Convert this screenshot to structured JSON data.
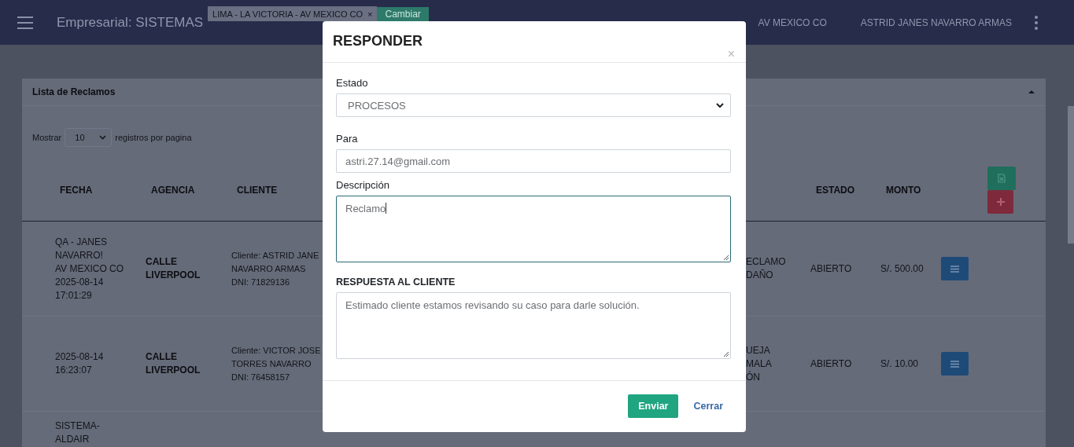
{
  "navbar": {
    "title": "Empresarial: SISTEMAS",
    "branch_select": "LIMA - LA VICTORIA - AV MEXICO CO",
    "branch_clear": "×",
    "change_button": "Cambiar",
    "branch_name": "AV MEXICO CO",
    "user_name": "ASTRID JANES NAVARRO ARMAS"
  },
  "card": {
    "title": "Lista de Reclamos",
    "length_label": "Mostrar",
    "length_value": "10",
    "length_suffix": "registros por pagina",
    "columns": [
      "FECHA",
      "AGENCIA",
      "CLIENTE",
      "ESTADO",
      "MONTO"
    ],
    "rows": [
      {
        "fecha": "QA - JANES NAVARRO!\nAV MEXICO CO\n2025-08-14\n17:01:29",
        "agencia": "CALLE\nLIVERPOOL",
        "cliente": "Cliente: ASTRID JANE\nNAVARRO ARMAS\nDNI: 71829136",
        "column_4": "ECLAMO\n DAÑO",
        "estado": "ABIERTO",
        "monto": "S/. 500.00"
      },
      {
        "fecha": "2025-08-14\n16:23:07",
        "agencia": "CALLE\nLIVERPOOL",
        "cliente": "Cliente: VICTOR JOSE\nTORRES NAVARRO\nDNI: 76458157",
        "column_4": "UEJA\n MALA\nÓN",
        "estado": "ABIERTO",
        "monto": "S/. 10.00"
      },
      {
        "fecha": "SISTEMA-\nALDAIR"
      }
    ]
  },
  "modal": {
    "title": "RESPONDER",
    "close": "×",
    "fields": [
      {
        "kind": "select",
        "label": "Estado",
        "value": "PROCESOS",
        "focused": false,
        "strong": false
      },
      {
        "kind": "input",
        "label": "Para",
        "value": "astri.27.14@gmail.com",
        "focused": false,
        "strong": false
      },
      {
        "kind": "textarea",
        "label": "Descripción",
        "value": "Reclamo",
        "focused": true,
        "strong": false
      },
      {
        "kind": "textarea",
        "label": "RESPUESTA AL CLIENTE",
        "value": "Estimado cliente estamos revisando su caso para darle solución.",
        "focused": false,
        "strong": true
      }
    ],
    "buttons": [
      {
        "kind": "primary",
        "label": "Enviar"
      },
      {
        "kind": "link",
        "label": "Cerrar"
      }
    ]
  }
}
